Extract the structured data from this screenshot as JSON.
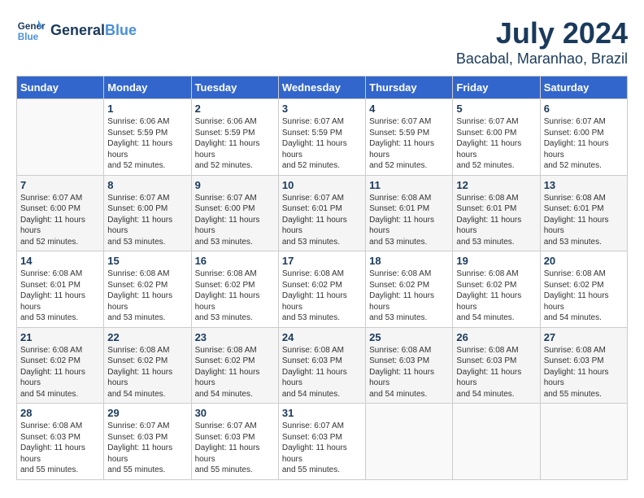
{
  "header": {
    "logo_line1": "General",
    "logo_line2": "Blue",
    "month": "July 2024",
    "location": "Bacabal, Maranhao, Brazil"
  },
  "weekdays": [
    "Sunday",
    "Monday",
    "Tuesday",
    "Wednesday",
    "Thursday",
    "Friday",
    "Saturday"
  ],
  "weeks": [
    [
      {
        "day": "",
        "sunrise": "",
        "sunset": "",
        "daylight": ""
      },
      {
        "day": "1",
        "sunrise": "Sunrise: 6:06 AM",
        "sunset": "Sunset: 5:59 PM",
        "daylight": "Daylight: 11 hours and 52 minutes."
      },
      {
        "day": "2",
        "sunrise": "Sunrise: 6:06 AM",
        "sunset": "Sunset: 5:59 PM",
        "daylight": "Daylight: 11 hours and 52 minutes."
      },
      {
        "day": "3",
        "sunrise": "Sunrise: 6:07 AM",
        "sunset": "Sunset: 5:59 PM",
        "daylight": "Daylight: 11 hours and 52 minutes."
      },
      {
        "day": "4",
        "sunrise": "Sunrise: 6:07 AM",
        "sunset": "Sunset: 5:59 PM",
        "daylight": "Daylight: 11 hours and 52 minutes."
      },
      {
        "day": "5",
        "sunrise": "Sunrise: 6:07 AM",
        "sunset": "Sunset: 6:00 PM",
        "daylight": "Daylight: 11 hours and 52 minutes."
      },
      {
        "day": "6",
        "sunrise": "Sunrise: 6:07 AM",
        "sunset": "Sunset: 6:00 PM",
        "daylight": "Daylight: 11 hours and 52 minutes."
      }
    ],
    [
      {
        "day": "7",
        "sunrise": "Sunrise: 6:07 AM",
        "sunset": "Sunset: 6:00 PM",
        "daylight": "Daylight: 11 hours and 52 minutes."
      },
      {
        "day": "8",
        "sunrise": "Sunrise: 6:07 AM",
        "sunset": "Sunset: 6:00 PM",
        "daylight": "Daylight: 11 hours and 53 minutes."
      },
      {
        "day": "9",
        "sunrise": "Sunrise: 6:07 AM",
        "sunset": "Sunset: 6:00 PM",
        "daylight": "Daylight: 11 hours and 53 minutes."
      },
      {
        "day": "10",
        "sunrise": "Sunrise: 6:07 AM",
        "sunset": "Sunset: 6:01 PM",
        "daylight": "Daylight: 11 hours and 53 minutes."
      },
      {
        "day": "11",
        "sunrise": "Sunrise: 6:08 AM",
        "sunset": "Sunset: 6:01 PM",
        "daylight": "Daylight: 11 hours and 53 minutes."
      },
      {
        "day": "12",
        "sunrise": "Sunrise: 6:08 AM",
        "sunset": "Sunset: 6:01 PM",
        "daylight": "Daylight: 11 hours and 53 minutes."
      },
      {
        "day": "13",
        "sunrise": "Sunrise: 6:08 AM",
        "sunset": "Sunset: 6:01 PM",
        "daylight": "Daylight: 11 hours and 53 minutes."
      }
    ],
    [
      {
        "day": "14",
        "sunrise": "Sunrise: 6:08 AM",
        "sunset": "Sunset: 6:01 PM",
        "daylight": "Daylight: 11 hours and 53 minutes."
      },
      {
        "day": "15",
        "sunrise": "Sunrise: 6:08 AM",
        "sunset": "Sunset: 6:02 PM",
        "daylight": "Daylight: 11 hours and 53 minutes."
      },
      {
        "day": "16",
        "sunrise": "Sunrise: 6:08 AM",
        "sunset": "Sunset: 6:02 PM",
        "daylight": "Daylight: 11 hours and 53 minutes."
      },
      {
        "day": "17",
        "sunrise": "Sunrise: 6:08 AM",
        "sunset": "Sunset: 6:02 PM",
        "daylight": "Daylight: 11 hours and 53 minutes."
      },
      {
        "day": "18",
        "sunrise": "Sunrise: 6:08 AM",
        "sunset": "Sunset: 6:02 PM",
        "daylight": "Daylight: 11 hours and 53 minutes."
      },
      {
        "day": "19",
        "sunrise": "Sunrise: 6:08 AM",
        "sunset": "Sunset: 6:02 PM",
        "daylight": "Daylight: 11 hours and 54 minutes."
      },
      {
        "day": "20",
        "sunrise": "Sunrise: 6:08 AM",
        "sunset": "Sunset: 6:02 PM",
        "daylight": "Daylight: 11 hours and 54 minutes."
      }
    ],
    [
      {
        "day": "21",
        "sunrise": "Sunrise: 6:08 AM",
        "sunset": "Sunset: 6:02 PM",
        "daylight": "Daylight: 11 hours and 54 minutes."
      },
      {
        "day": "22",
        "sunrise": "Sunrise: 6:08 AM",
        "sunset": "Sunset: 6:02 PM",
        "daylight": "Daylight: 11 hours and 54 minutes."
      },
      {
        "day": "23",
        "sunrise": "Sunrise: 6:08 AM",
        "sunset": "Sunset: 6:02 PM",
        "daylight": "Daylight: 11 hours and 54 minutes."
      },
      {
        "day": "24",
        "sunrise": "Sunrise: 6:08 AM",
        "sunset": "Sunset: 6:03 PM",
        "daylight": "Daylight: 11 hours and 54 minutes."
      },
      {
        "day": "25",
        "sunrise": "Sunrise: 6:08 AM",
        "sunset": "Sunset: 6:03 PM",
        "daylight": "Daylight: 11 hours and 54 minutes."
      },
      {
        "day": "26",
        "sunrise": "Sunrise: 6:08 AM",
        "sunset": "Sunset: 6:03 PM",
        "daylight": "Daylight: 11 hours and 54 minutes."
      },
      {
        "day": "27",
        "sunrise": "Sunrise: 6:08 AM",
        "sunset": "Sunset: 6:03 PM",
        "daylight": "Daylight: 11 hours and 55 minutes."
      }
    ],
    [
      {
        "day": "28",
        "sunrise": "Sunrise: 6:08 AM",
        "sunset": "Sunset: 6:03 PM",
        "daylight": "Daylight: 11 hours and 55 minutes."
      },
      {
        "day": "29",
        "sunrise": "Sunrise: 6:07 AM",
        "sunset": "Sunset: 6:03 PM",
        "daylight": "Daylight: 11 hours and 55 minutes."
      },
      {
        "day": "30",
        "sunrise": "Sunrise: 6:07 AM",
        "sunset": "Sunset: 6:03 PM",
        "daylight": "Daylight: 11 hours and 55 minutes."
      },
      {
        "day": "31",
        "sunrise": "Sunrise: 6:07 AM",
        "sunset": "Sunset: 6:03 PM",
        "daylight": "Daylight: 11 hours and 55 minutes."
      },
      {
        "day": "",
        "sunrise": "",
        "sunset": "",
        "daylight": ""
      },
      {
        "day": "",
        "sunrise": "",
        "sunset": "",
        "daylight": ""
      },
      {
        "day": "",
        "sunrise": "",
        "sunset": "",
        "daylight": ""
      }
    ]
  ]
}
